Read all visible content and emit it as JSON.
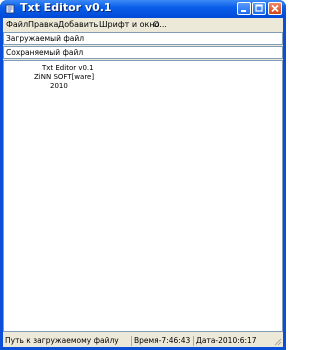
{
  "window": {
    "title": "Txt Editor v0.1",
    "colors": {
      "titlebar": "#0a5fe9",
      "close": "#d24415",
      "face": "#ece9d8"
    }
  },
  "menu": {
    "items": [
      "Файл",
      "Правка",
      "Добавить",
      "Шрифт и окно",
      "О..."
    ]
  },
  "fields": {
    "loaded_file_label": "Загружаемый файл",
    "saved_file_label": "Сохраняемый файл"
  },
  "editor": {
    "lines": [
      "Txt Editor v0.1",
      "ZiNN SOFT[ware]",
      "2010"
    ]
  },
  "status": {
    "path_hint": "Путь к загружаемому файлу",
    "time": "Время-7:46:43",
    "date": "Дата-2010:6:17"
  },
  "icons": {
    "app": "notepad-icon",
    "minimize": "minimize-icon",
    "maximize": "maximize-icon",
    "close": "close-icon"
  }
}
